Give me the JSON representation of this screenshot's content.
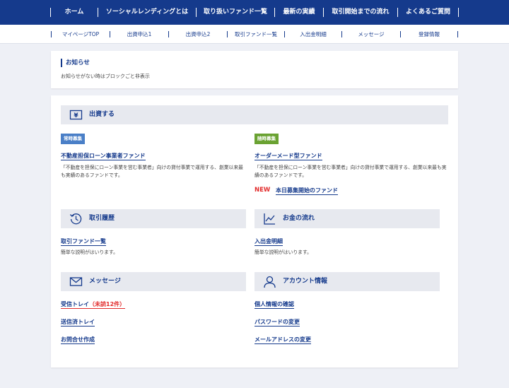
{
  "top_nav": {
    "items": [
      "ホーム",
      "ソーシャルレンディングとは",
      "取り扱いファンド一覧",
      "最新の実績",
      "取引開始までの流れ",
      "よくあるご質問"
    ]
  },
  "sub_nav": {
    "items": [
      "マイページTOP",
      "出資申込1",
      "出資申込2",
      "取引ファンド一覧",
      "入出金明細",
      "メッセージ",
      "登録情報"
    ]
  },
  "notice": {
    "title": "お知らせ",
    "body": "お知らせがない時はブロックごと非表示"
  },
  "invest": {
    "heading": "出資する",
    "left": {
      "badge": "常時募集",
      "link": "不動産担保ローン事業者ファンド",
      "desc": "「不動産を担保にローン事業を営む事業者」向けの貸付事業で運用する、創業以来最も実績のあるファンドです。"
    },
    "right": {
      "badge": "随時募集",
      "link": "オーダーメード型ファンド",
      "desc": "「不動産を担保にローン事業を営む事業者」向けの貸付事業で運用する、創業以来最も実績のあるファンドです。",
      "new_label": "NEW",
      "new_link": "本日募集開始のファンド"
    }
  },
  "history": {
    "heading": "取引履歴",
    "link": "取引ファンド一覧",
    "desc": "簡単な説明がはいります。"
  },
  "money": {
    "heading": "お金の流れ",
    "link": "入出金明細",
    "desc": "簡単な説明がはいります。"
  },
  "message": {
    "heading": "メッセージ",
    "inbox_link": "受信トレイ",
    "inbox_unread": "（未読12件）",
    "sent_link": "送信済トレイ",
    "contact_link": "お問合せ作成"
  },
  "account": {
    "heading": "アカウント情報",
    "profile_link": "個人情報の確認",
    "password_link": "パスワードの変更",
    "email_link": "メールアドレスの変更"
  },
  "colors": {
    "navy": "#153a8c",
    "badge_blue": "#4a7fc7",
    "badge_green": "#6aa232",
    "alert_red": "#e22b2b"
  }
}
